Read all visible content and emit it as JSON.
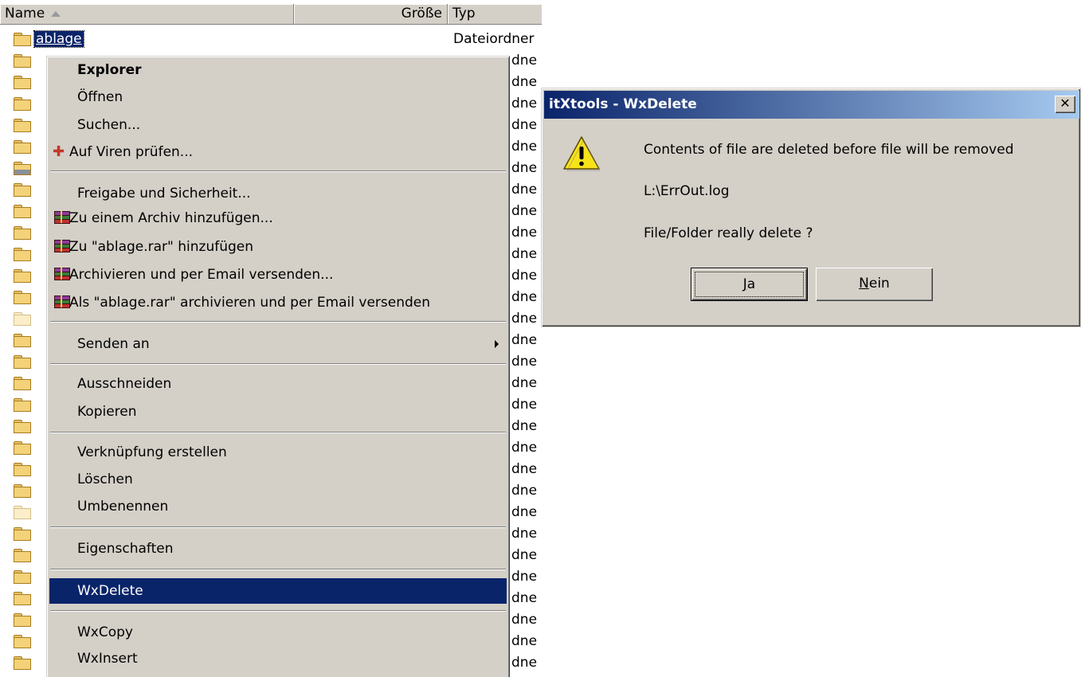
{
  "explorer": {
    "columns": {
      "name": "Name",
      "size": "Größe",
      "type": "Typ"
    },
    "rows": [
      {
        "name": "ablage",
        "type": "Dateiordner",
        "selected": true
      },
      {
        "type_partial": "dne"
      },
      {
        "type_partial": "dne"
      },
      {
        "type_partial": "dne"
      },
      {
        "type_partial": "dne"
      },
      {
        "type_partial": "dne"
      },
      {
        "type_partial": "dne",
        "icon": "special"
      },
      {
        "type_partial": "dne"
      },
      {
        "type_partial": "dne"
      },
      {
        "type_partial": "dne"
      },
      {
        "type_partial": "dne"
      },
      {
        "type_partial": "dne"
      },
      {
        "type_partial": "dne"
      },
      {
        "type_partial": "dne",
        "icon": "pale"
      },
      {
        "type_partial": "dne"
      },
      {
        "type_partial": "dne"
      },
      {
        "type_partial": "dne"
      },
      {
        "type_partial": "dne"
      },
      {
        "type_partial": "dne"
      },
      {
        "type_partial": "dne"
      },
      {
        "type_partial": "dne"
      },
      {
        "type_partial": "dne"
      },
      {
        "type_partial": "dne",
        "icon": "pale"
      },
      {
        "type_partial": "dne"
      },
      {
        "type_partial": "dne"
      },
      {
        "type_partial": "dne"
      },
      {
        "type_partial": "dne"
      },
      {
        "type_partial": "dne"
      },
      {
        "type_partial": "dne"
      },
      {
        "type_partial": "dne"
      }
    ]
  },
  "context_menu": {
    "items": {
      "explorer": "Explorer",
      "open": "Öffnen",
      "search": "Suchen...",
      "virus_scan": "Auf Viren prüfen...",
      "sharing": "Freigabe und Sicherheit...",
      "add_archive": "Zu einem Archiv hinzufügen...",
      "add_rar": "Zu \"ablage.rar\" hinzufügen",
      "archive_email": "Archivieren und per Email versenden...",
      "rar_email": "Als \"ablage.rar\" archivieren und per Email versenden",
      "send_to": "Senden an",
      "cut": "Ausschneiden",
      "copy": "Kopieren",
      "shortcut": "Verknüpfung erstellen",
      "delete": "Löschen",
      "rename": "Umbenennen",
      "properties": "Eigenschaften",
      "wxdelete": "WxDelete",
      "wxcopy": "WxCopy",
      "wxinsert": "WxInsert"
    },
    "highlighted": "WxDelete"
  },
  "dialog": {
    "title": "itXtools - WxDelete",
    "close_glyph": "✕",
    "message": "Contents of file are deleted before file will be  removed",
    "path": "L:\\ErrOut.log",
    "question": "File/Folder really delete ?",
    "yes_accel": "J",
    "yes_rest": "a",
    "no_accel": "N",
    "no_rest": "ein",
    "icon": "warning-icon"
  },
  "colors": {
    "selection": "#0a246a",
    "titlebar_start": "#0a246a",
    "titlebar_end": "#a6caf0",
    "face": "#d4d0c8"
  }
}
